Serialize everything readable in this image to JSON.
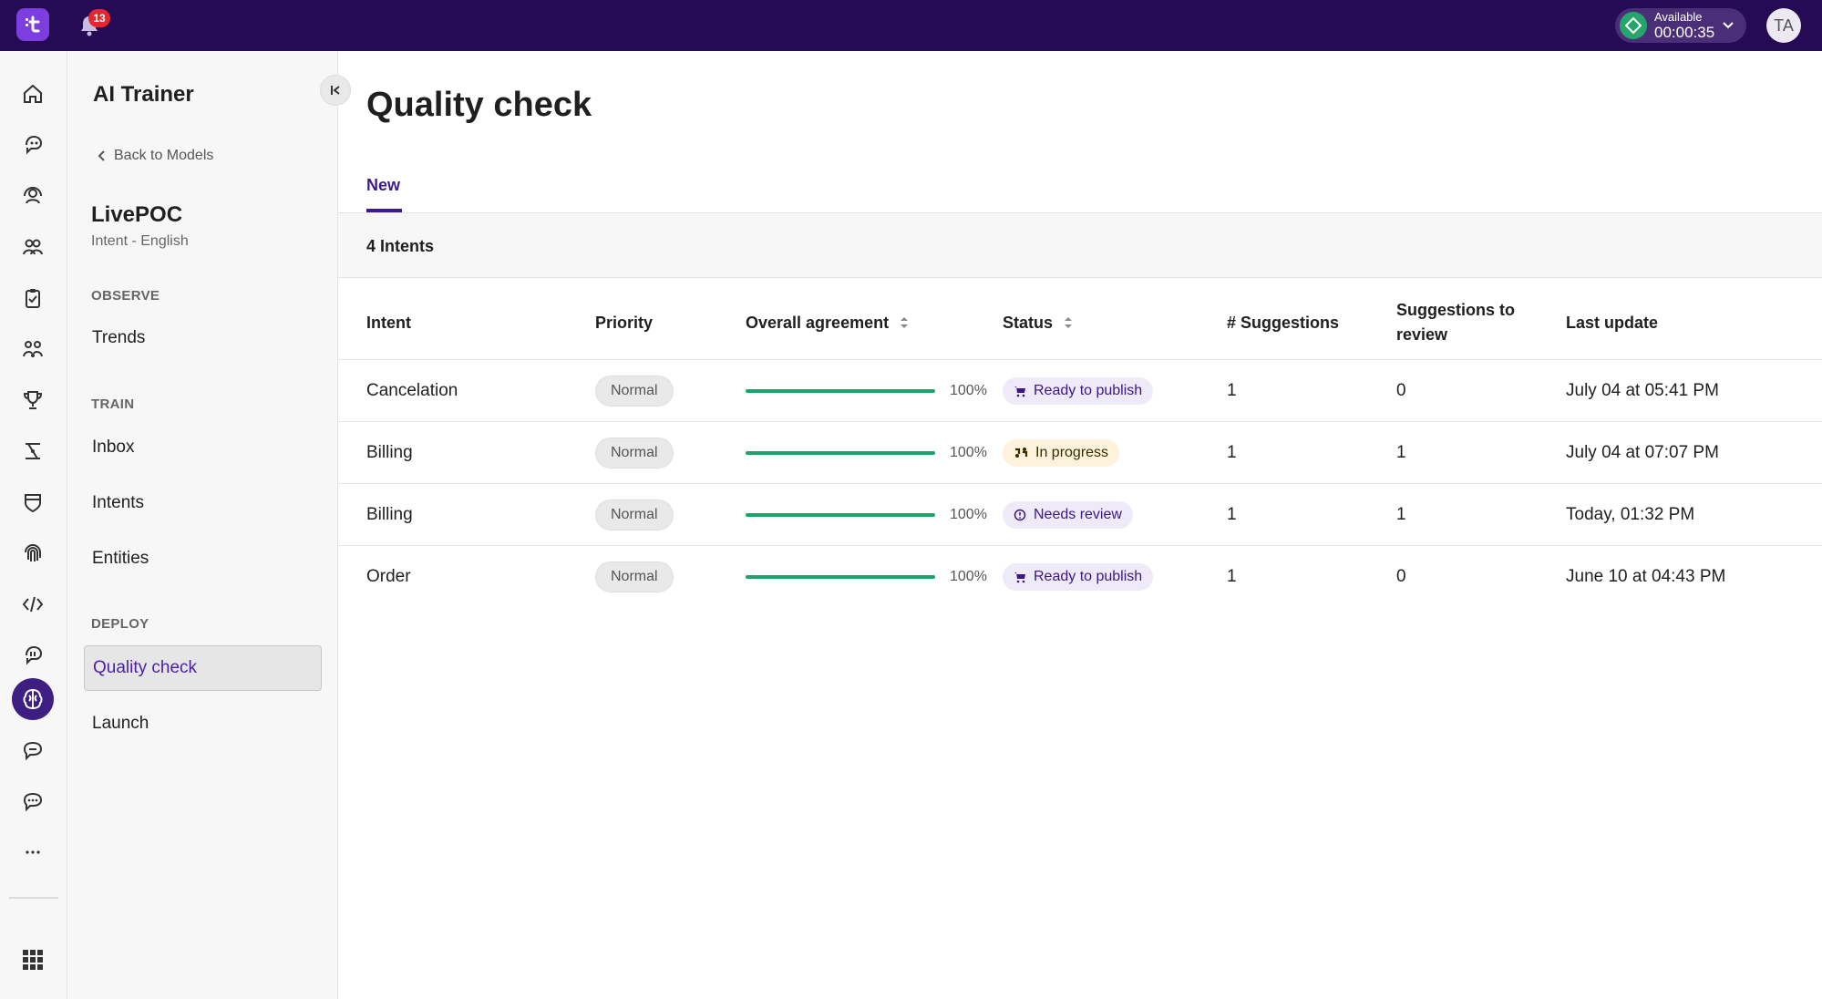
{
  "topbar": {
    "notifications_count": "13",
    "status_label": "Available",
    "status_time": "00:00:35",
    "avatar_initials": "TA"
  },
  "sidebar": {
    "title": "AI Trainer",
    "back_link": "Back to Models",
    "model_name": "LivePOC",
    "model_subtitle": "Intent - English",
    "sections": {
      "observe": "OBSERVE",
      "train": "TRAIN",
      "deploy": "DEPLOY"
    },
    "items": {
      "trends": "Trends",
      "inbox": "Inbox",
      "intents": "Intents",
      "entities": "Entities",
      "quality_check": "Quality check",
      "launch": "Launch"
    }
  },
  "main": {
    "title": "Quality check",
    "tab_new": "New",
    "count_label": "4 Intents",
    "columns": {
      "intent": "Intent",
      "priority": "Priority",
      "agreement": "Overall agreement",
      "status": "Status",
      "suggestions": "# Suggestions",
      "to_review_1": "Suggestions to",
      "to_review_2": "review",
      "last_update": "Last update"
    },
    "rows": [
      {
        "intent": "Cancelation",
        "priority": "Normal",
        "agreement_pct": "100%",
        "agreement": 1.0,
        "status": "Ready to publish",
        "status_type": "ready",
        "suggestions": "1",
        "to_review": "0",
        "last_update": "July 04 at 05:41 PM"
      },
      {
        "intent": "Billing",
        "priority": "Normal",
        "agreement_pct": "100%",
        "agreement": 1.0,
        "status": "In progress",
        "status_type": "progress",
        "suggestions": "1",
        "to_review": "1",
        "last_update": "July 04 at 07:07 PM"
      },
      {
        "intent": "Billing",
        "priority": "Normal",
        "agreement_pct": "100%",
        "agreement": 1.0,
        "status": "Needs review",
        "status_type": "review",
        "suggestions": "1",
        "to_review": "1",
        "last_update": "Today, 01:32 PM"
      },
      {
        "intent": "Order",
        "priority": "Normal",
        "agreement_pct": "100%",
        "agreement": 1.0,
        "status": "Ready to publish",
        "status_type": "ready",
        "suggestions": "1",
        "to_review": "0",
        "last_update": "June 10 at 04:43 PM"
      }
    ]
  },
  "colors": {
    "topbar_bg": "#250a54",
    "accent": "#3f1a8c",
    "agreement_bar": "#1ca36b",
    "ready_badge_bg": "#efeaf8",
    "progress_badge_bg": "#fdf3dd"
  },
  "icons": {
    "rail": [
      "home-icon",
      "chat-bot-icon",
      "agent-icon",
      "team-icon",
      "clipboard-check-icon",
      "group-activity-icon",
      "trophy-icon",
      "workflow-icon",
      "shield-icon",
      "fingerprint-icon",
      "code-icon",
      "integration-icon",
      "ai-brain-icon",
      "conversation-icon",
      "chat-icon",
      "more-icon",
      "apps-grid-icon"
    ]
  }
}
